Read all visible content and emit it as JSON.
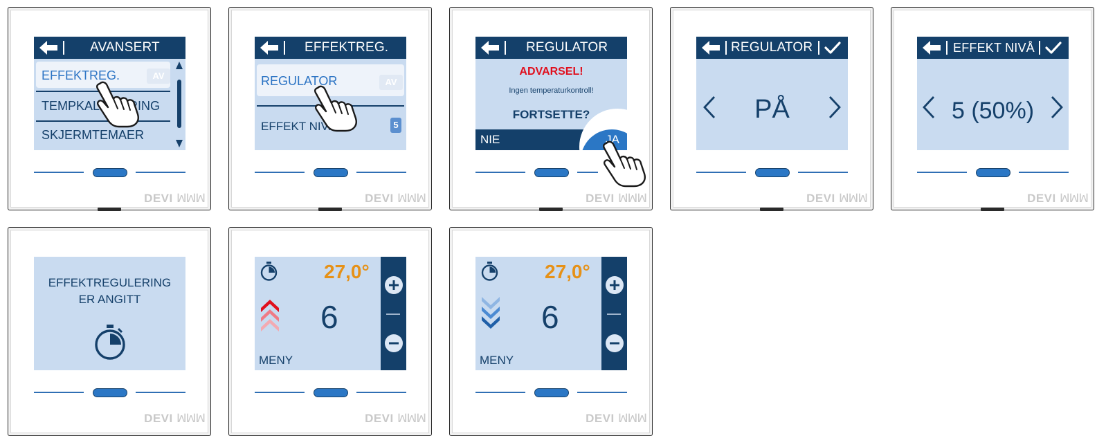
{
  "brand": {
    "name": "DEVI",
    "mark": "ꟽꟽꟽ"
  },
  "screens": {
    "s1": {
      "title": "AVANSERT",
      "items": [
        "EFFEKTREG.",
        "TEMPKALIBRERING",
        "SKJERMTEMAER"
      ],
      "badge": "AV"
    },
    "s2": {
      "title": "EFFEKTREG.",
      "items": [
        "REGULATOR",
        "EFFEKT NIVÅ"
      ],
      "badge_top": "AV",
      "badge_bottom": "5"
    },
    "s3": {
      "title": "REGULATOR",
      "warning": "ADVARSEL!",
      "message": "Ingen temperaturkontroll!",
      "question": "FORTSETTE?",
      "no_label": "NIE",
      "yes_label": "JA"
    },
    "s4": {
      "title": "REGULATOR",
      "value": "PÅ"
    },
    "s5": {
      "title": "EFFEKT NIVÅ",
      "value": "5 (50%)"
    },
    "s6": {
      "line1": "EFFEKTREGULERING",
      "line2": "ER ANGITT"
    },
    "s7": {
      "temp": "27,0°",
      "level": "6",
      "menu": "MENY"
    },
    "s8": {
      "temp": "27,0°",
      "level": "6",
      "menu": "MENY"
    }
  },
  "colors": {
    "header": "#14406a",
    "screen_bg": "#c9dbf0",
    "accent_blue": "#2b77c5",
    "warning_red": "#e0101e",
    "temp_orange": "#e69117"
  }
}
